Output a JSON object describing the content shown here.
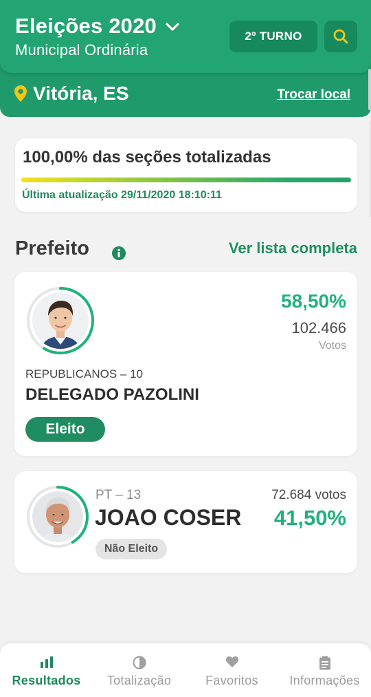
{
  "header": {
    "title": "Eleições 2020",
    "subtitle": "Municipal Ordinária",
    "turno_label": "2º TURNO",
    "location": "Vitória, ES",
    "change_location": "Trocar local",
    "colors": {
      "primary": "#22a572",
      "dark": "#178a5d",
      "pin": "#f5c518"
    }
  },
  "progress": {
    "title": "100,00% das seções totalizadas",
    "value": 1.0,
    "updated": "Última atualização 29/11/2020 18:10:11"
  },
  "section": {
    "title": "Prefeito",
    "see_all": "Ver lista completa"
  },
  "candidates": [
    {
      "party": "REPUBLICANOS – 10",
      "name": "DELEGADO PAZOLINI",
      "percent": "58,50%",
      "percent_value": 58.5,
      "votes": "102.466",
      "votes_label": "Votos",
      "status": "Eleito"
    },
    {
      "party": "PT – 13",
      "name": "JOAO COSER",
      "percent": "41,50%",
      "percent_value": 41.5,
      "votes": "72.684 votos",
      "status": "Não Eleito"
    }
  ],
  "nav": [
    {
      "label": "Resultados",
      "icon": "bar-chart-icon",
      "active": true
    },
    {
      "label": "Totalização",
      "icon": "pie-icon",
      "active": false
    },
    {
      "label": "Favoritos",
      "icon": "heart-icon",
      "active": false
    },
    {
      "label": "Informações",
      "icon": "clipboard-icon",
      "active": false
    }
  ]
}
